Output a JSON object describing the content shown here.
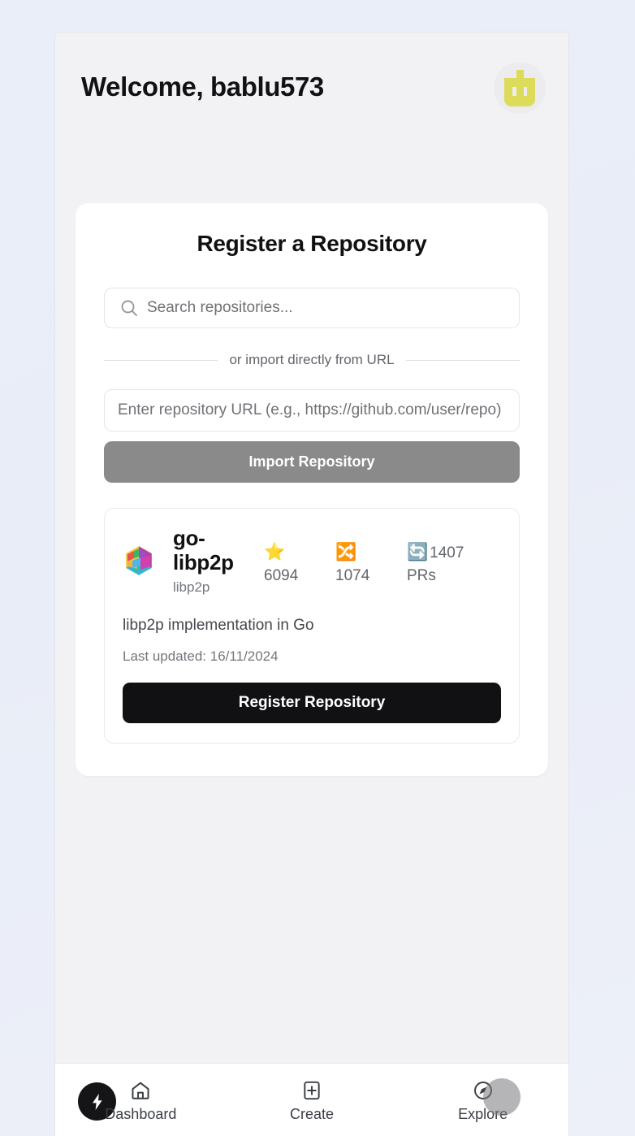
{
  "colors": {
    "page_background": "#e9edf7",
    "panel_background": "#f2f2f4",
    "card_background": "#ffffff",
    "accent_dark": "#111113",
    "import_button": "#8a8a8a",
    "avatar_yellow": "#dcdc5a",
    "muted_text": "#73767c"
  },
  "header": {
    "greeting": "Welcome, bablu573",
    "avatar_icon": "user-identicon-avatar"
  },
  "register_card": {
    "title": "Register a Repository",
    "search": {
      "icon": "search-icon",
      "placeholder": "Search repositories...",
      "value": ""
    },
    "divider_label": "or import directly from URL",
    "url_field": {
      "placeholder": "Enter repository URL (e.g., https://github.com/user/repo)",
      "value": ""
    },
    "import_button_label": "Import Repository"
  },
  "repository": {
    "logo_icon": "libp2p-cube-logo",
    "name": "go-libp2p",
    "owner": "libp2p",
    "description": "libp2p implementation in Go",
    "last_updated_label": "Last updated: 16/11/2024",
    "register_button_label": "Register Repository",
    "stats": [
      {
        "icon": "star-emoji",
        "glyph": "⭐",
        "value": "6094",
        "suffix": ""
      },
      {
        "icon": "shuffle-emoji",
        "glyph": "🔀",
        "value": "1074",
        "suffix": ""
      },
      {
        "icon": "refresh-emoji",
        "glyph": "🔄",
        "value": "1407",
        "suffix": "PRs"
      }
    ]
  },
  "bottom_nav": {
    "badge_icon": "lightning-bolt-icon",
    "items": [
      {
        "icon": "home-icon",
        "label": "Dashboard"
      },
      {
        "icon": "plus-square-icon",
        "label": "Create"
      },
      {
        "icon": "compass-icon",
        "label": "Explore"
      }
    ]
  }
}
